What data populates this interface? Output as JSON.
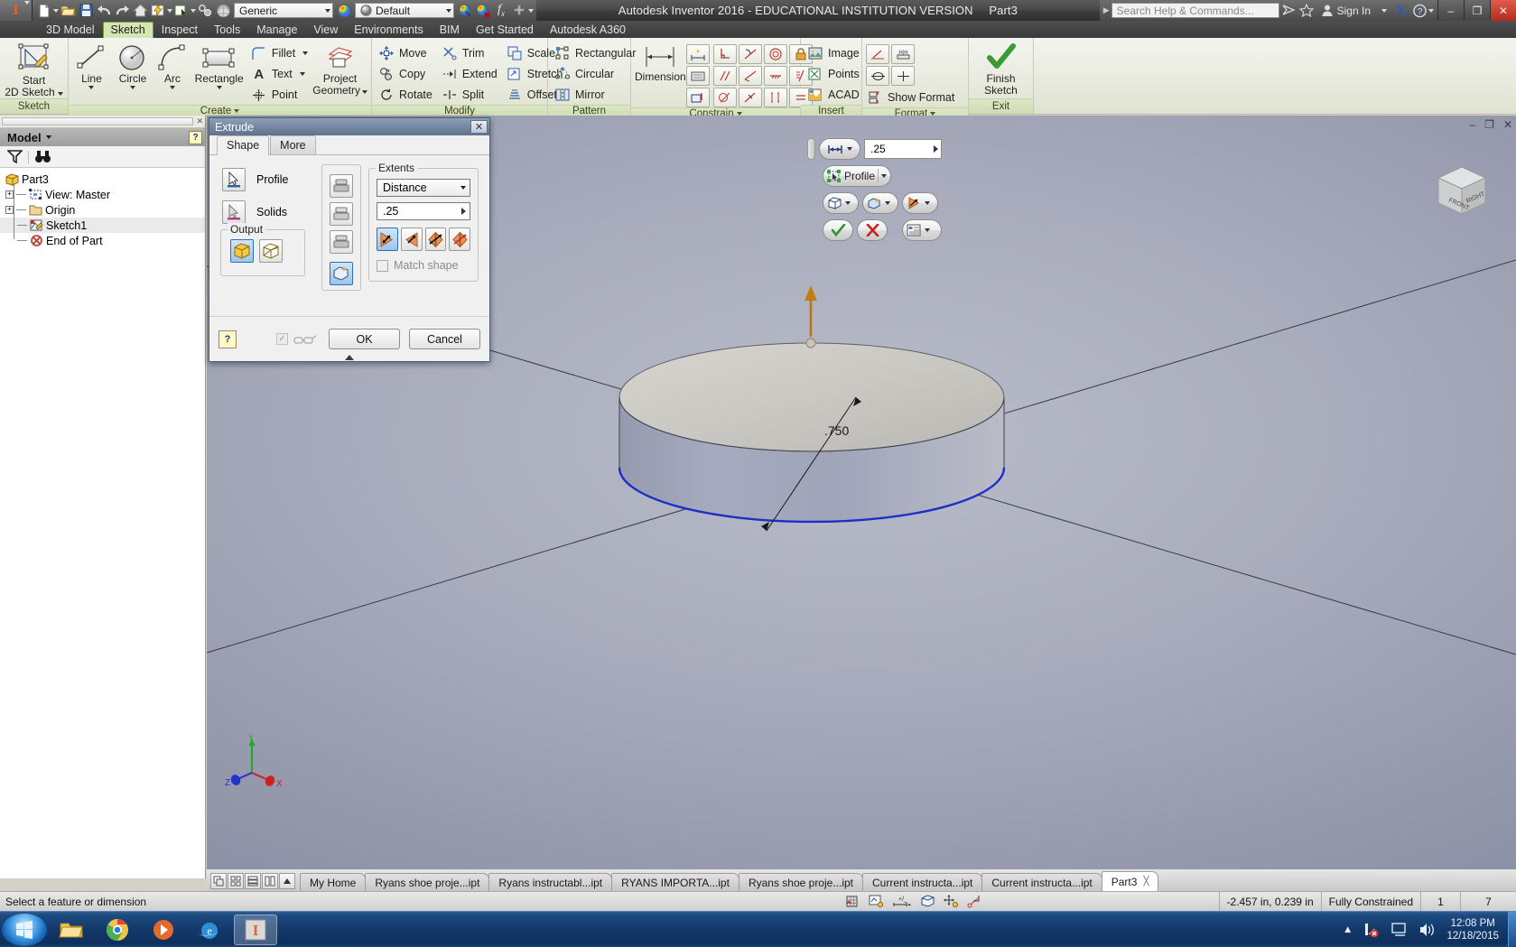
{
  "titlebar": {
    "app_title": "Autodesk Inventor 2016 - EDUCATIONAL INSTITUTION VERSION",
    "document_name": "Part3",
    "material_combo": "Generic",
    "appearance_combo": "Default",
    "search_placeholder": "Search Help & Commands...",
    "sign_in": "Sign In",
    "help_glyph": "?",
    "minimize": "–",
    "maximize": "❐",
    "close": "✕"
  },
  "ribbon": {
    "tabs": [
      {
        "label": "3D Model",
        "active": false
      },
      {
        "label": "Sketch",
        "active": true
      },
      {
        "label": "Inspect",
        "active": false
      },
      {
        "label": "Tools",
        "active": false
      },
      {
        "label": "Manage",
        "active": false
      },
      {
        "label": "View",
        "active": false
      },
      {
        "label": "Environments",
        "active": false
      },
      {
        "label": "BIM",
        "active": false
      },
      {
        "label": "Get Started",
        "active": false
      },
      {
        "label": "Autodesk A360",
        "active": false
      }
    ],
    "panels": {
      "sketch": {
        "title": "Sketch",
        "start_2d_sketch_l1": "Start",
        "start_2d_sketch_l2": "2D Sketch"
      },
      "create": {
        "title": "Create",
        "line": "Line",
        "circle": "Circle",
        "arc": "Arc",
        "rectangle": "Rectangle",
        "fillet": "Fillet",
        "text": "Text",
        "point": "Point",
        "project_geometry_l1": "Project",
        "project_geometry_l2": "Geometry"
      },
      "modify": {
        "title": "Modify",
        "move": "Move",
        "copy": "Copy",
        "rotate": "Rotate",
        "trim": "Trim",
        "extend": "Extend",
        "split": "Split",
        "scale": "Scale",
        "stretch": "Stretch",
        "offset": "Offset"
      },
      "pattern": {
        "title": "Pattern",
        "rectangular": "Rectangular",
        "circular": "Circular",
        "mirror": "Mirror"
      },
      "constrain": {
        "title": "Constrain",
        "dimension": "Dimension"
      },
      "insert": {
        "title": "Insert",
        "image": "Image",
        "points": "Points",
        "acad": "ACAD"
      },
      "format": {
        "title": "Format",
        "show_format": "Show Format"
      },
      "exit": {
        "title": "Exit",
        "finish_sketch_l1": "Finish",
        "finish_sketch_l2": "Sketch"
      }
    }
  },
  "browser": {
    "header_label": "Model",
    "help_glyph": "?",
    "tree": [
      {
        "label": "Part3",
        "depth": 0,
        "expander": "",
        "icon": "part-icon",
        "selected": false
      },
      {
        "label": "View: Master",
        "depth": 1,
        "expander": "+",
        "icon": "view-icon",
        "selected": false
      },
      {
        "label": "Origin",
        "depth": 1,
        "expander": "+",
        "icon": "folder-icon",
        "selected": false
      },
      {
        "label": "Sketch1",
        "depth": 1,
        "expander": "",
        "icon": "sketch-icon",
        "selected": true
      },
      {
        "label": "End of Part",
        "depth": 1,
        "expander": "",
        "icon": "end-of-part-icon",
        "selected": false
      }
    ]
  },
  "dialog": {
    "title": "Extrude",
    "close_glyph": "✕",
    "tabs": [
      {
        "label": "Shape",
        "active": true
      },
      {
        "label": "More",
        "active": false
      }
    ],
    "profile_label": "Profile",
    "solids_label": "Solids",
    "output_group": "Output",
    "extents_group": "Extents",
    "extents_type": "Distance",
    "distance_value": ".25",
    "match_shape_label": "Match shape",
    "match_shape_checked": false,
    "help_glyph": "?",
    "ok_label": "OK",
    "cancel_label": "Cancel"
  },
  "mini_toolbar": {
    "distance_value": ".25",
    "profile_label": "Profile",
    "ok_glyph": "✓",
    "cancel_glyph": "✕"
  },
  "graphics": {
    "dimension_value": ".750",
    "viewcube_front": "FRONT",
    "viewcube_right": "RIGHT",
    "axis_x": "X",
    "axis_y": "Y",
    "axis_z": "Z",
    "win_minimize": "–",
    "win_restore": "❐",
    "win_close": "✕"
  },
  "doctabs": [
    {
      "label": "My Home",
      "active": false,
      "closable": false
    },
    {
      "label": "Ryans shoe proje...ipt",
      "active": false,
      "closable": false
    },
    {
      "label": "Ryans instructabl...ipt",
      "active": false,
      "closable": false
    },
    {
      "label": "RYANS IMPORTA...ipt",
      "active": false,
      "closable": false
    },
    {
      "label": "Ryans shoe proje...ipt",
      "active": false,
      "closable": false
    },
    {
      "label": "Current instructa...ipt",
      "active": false,
      "closable": false
    },
    {
      "label": "Current instructa...ipt",
      "active": false,
      "closable": false
    },
    {
      "label": "Part3",
      "active": true,
      "closable": true
    }
  ],
  "statusbar": {
    "prompt": "Select a feature or dimension",
    "coordinates": "-2.457 in, 0.239 in",
    "constraint_state": "Fully Constrained",
    "dimension_count": "1",
    "entity_count": "7"
  },
  "taskbar": {
    "clock_time": "12:08 PM",
    "clock_date": "12/18/2015"
  },
  "colors": {
    "accent_green": "#7a9b3c",
    "titlebar_dark": "#3d3d3d",
    "dialog_title": "#5d728c",
    "selection_blue": "#2f6fb0",
    "taskbar_blue": "#13396a"
  }
}
